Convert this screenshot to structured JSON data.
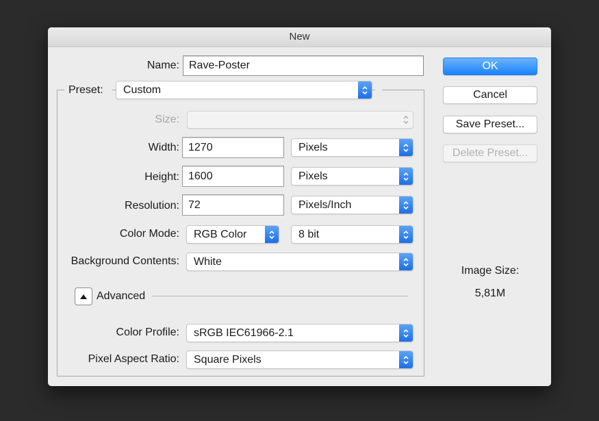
{
  "dialog": {
    "title": "New",
    "name": {
      "label": "Name:",
      "value": "Rave-Poster"
    },
    "preset": {
      "label": "Preset:",
      "value": "Custom"
    },
    "size": {
      "label": "Size:",
      "value": ""
    },
    "width": {
      "label": "Width:",
      "value": "1270",
      "unit": "Pixels"
    },
    "height": {
      "label": "Height:",
      "value": "1600",
      "unit": "Pixels"
    },
    "resolution": {
      "label": "Resolution:",
      "value": "72",
      "unit": "Pixels/Inch"
    },
    "color_mode": {
      "label": "Color Mode:",
      "value": "RGB Color",
      "depth": "8 bit"
    },
    "background": {
      "label": "Background Contents:",
      "value": "White"
    },
    "advanced": {
      "label": "Advanced"
    },
    "color_profile": {
      "label": "Color Profile:",
      "value": "sRGB IEC61966-2.1"
    },
    "pixel_aspect": {
      "label": "Pixel Aspect Ratio:",
      "value": "Square Pixels"
    }
  },
  "buttons": {
    "ok": "OK",
    "cancel": "Cancel",
    "save_preset": "Save Preset...",
    "delete_preset": "Delete Preset..."
  },
  "image_size": {
    "label": "Image Size:",
    "value": "5,81M"
  },
  "icons": {
    "select_arrow": "up-down-chevron-icon",
    "advanced_toggle": "triangle-up-icon"
  },
  "colors": {
    "accent": "#1a82fb",
    "background": "#2b2b2b",
    "dialog": "#ececec"
  }
}
